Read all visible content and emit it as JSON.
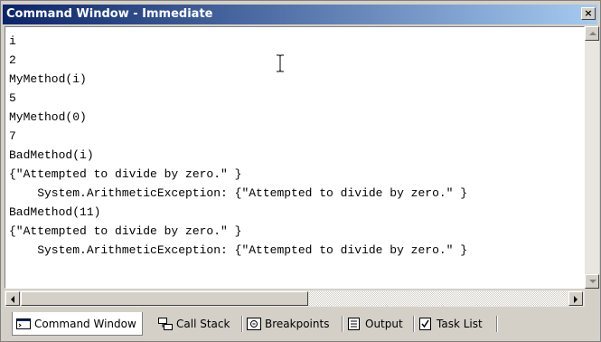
{
  "window": {
    "title": "Command Window - Immediate",
    "close_label": "×"
  },
  "editor": {
    "lines": [
      "i",
      "2",
      "MyMethod(i)",
      "5",
      "MyMethod(0)",
      "7",
      "BadMethod(i)",
      "{\"Attempted to divide by zero.\" }",
      "    System.ArithmeticException: {\"Attempted to divide by zero.\" }",
      "BadMethod(11)",
      "{\"Attempted to divide by zero.\" }",
      "    System.ArithmeticException: {\"Attempted to divide by zero.\" }"
    ]
  },
  "tabs": [
    {
      "label": "Command Window",
      "icon": "command-window-icon",
      "active": true
    },
    {
      "label": "Call Stack",
      "icon": "call-stack-icon",
      "active": false
    },
    {
      "label": "Breakpoints",
      "icon": "breakpoints-icon",
      "active": false
    },
    {
      "label": "Output",
      "icon": "output-icon",
      "active": false
    },
    {
      "label": "Task List",
      "icon": "task-list-icon",
      "active": false
    }
  ],
  "colors": {
    "titlebar_start": "#0a246a",
    "titlebar_end": "#a6caf0",
    "chrome": "#d4d0c8"
  }
}
